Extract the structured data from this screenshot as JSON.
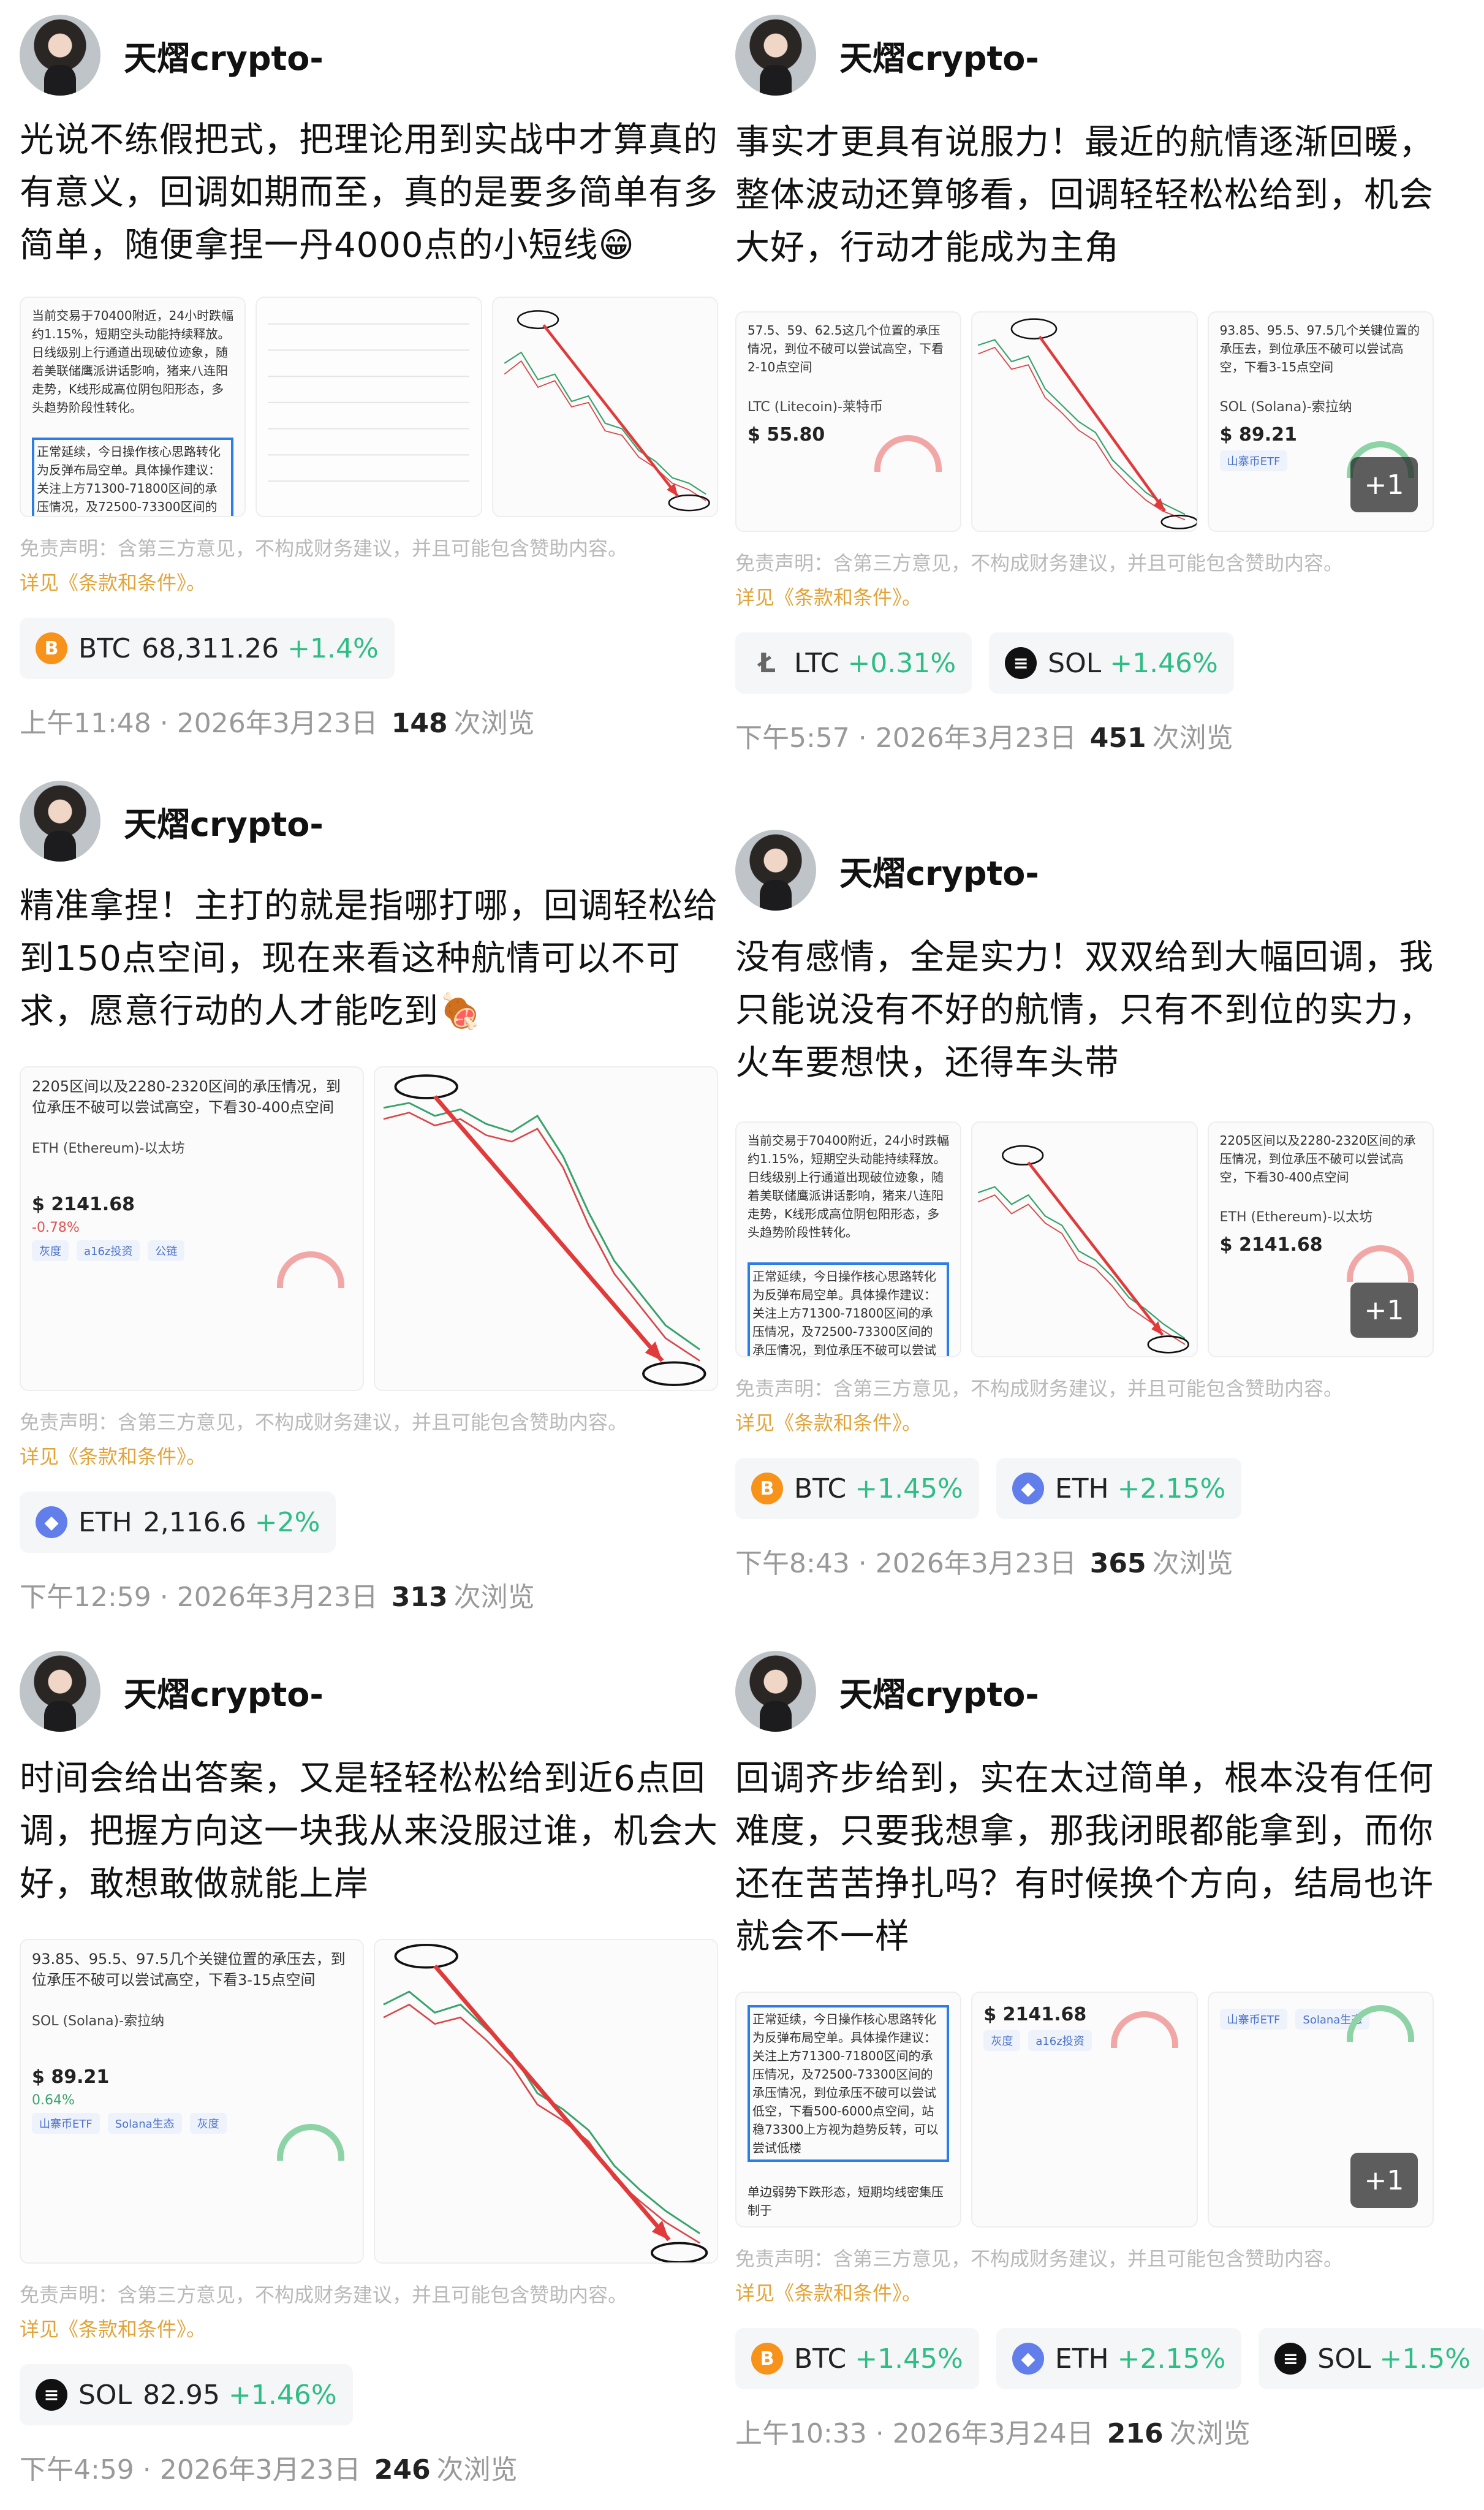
{
  "posts": [
    {
      "author": "天熠crypto-",
      "text": "光说不练假把式，把理论用到实战中才算真的有意义，回调如期而至，真的是要多简单有多简单，随便拿捏一丹4000点的小短线😁",
      "disclaimer": "免责声明：含第三方意见，不构成财务建议，并且可能包含赞助内容。",
      "terms": "详见《条款和条件》。",
      "tickers": [
        {
          "icon": "B",
          "type": "btc",
          "symbol": "BTC",
          "price": "68,311.26",
          "change": "+1.4%"
        }
      ],
      "time": "上午11:48 · 2026年3月23日",
      "views": "148",
      "views_label": "次浏览"
    },
    {
      "author": "天熠crypto-",
      "text": "事实才更具有说服力！最近的航情逐渐回暖，整体波动还算够看，回调轻轻松松给到，机会大好，行动才能成为主角",
      "disclaimer": "免责声明：含第三方意见，不构成财务建议，并且可能包含赞助内容。",
      "terms": "详见《条款和条件》。",
      "tickers": [
        {
          "icon": "Ł",
          "type": "ltc",
          "symbol": "LTC",
          "price": "",
          "change": "+0.31%"
        },
        {
          "icon": "≡",
          "type": "sol",
          "symbol": "SOL",
          "price": "",
          "change": "+1.46%"
        }
      ],
      "time": "下午5:57 · 2026年3月23日",
      "views": "451",
      "views_label": "次浏览",
      "plus": "+1"
    },
    {
      "author": "天熠crypto-",
      "text": "精准拿捏！主打的就是指哪打哪，回调轻松给到150点空间，现在来看这种航情可以不可求，愿意行动的人才能吃到🍖",
      "disclaimer": "免责声明：含第三方意见，不构成财务建议，并且可能包含赞助内容。",
      "terms": "详见《条款和条件》。",
      "tickers": [
        {
          "icon": "◆",
          "type": "eth",
          "symbol": "ETH",
          "price": "2,116.6",
          "change": "+2%"
        }
      ],
      "time": "下午12:59 · 2026年3月23日",
      "views": "313",
      "views_label": "次浏览"
    },
    {
      "author": "天熠crypto-",
      "text": "没有感情，全是实力！双双给到大幅回调，我只能说没有不好的航情，只有不到位的实力，火车要想快，还得车头带",
      "disclaimer": "免责声明：含第三方意见，不构成财务建议，并且可能包含赞助内容。",
      "terms": "详见《条款和条件》。",
      "tickers": [
        {
          "icon": "B",
          "type": "btc",
          "symbol": "BTC",
          "price": "",
          "change": "+1.45%"
        },
        {
          "icon": "◆",
          "type": "eth",
          "symbol": "ETH",
          "price": "",
          "change": "+2.15%"
        }
      ],
      "time": "下午8:43 · 2026年3月23日",
      "views": "365",
      "views_label": "次浏览",
      "plus": "+1"
    },
    {
      "author": "天熠crypto-",
      "text": "时间会给出答案，又是轻轻松松给到近6点回调，把握方向这一块我从来没服过谁，机会大好，敢想敢做就能上岸",
      "disclaimer": "免责声明：含第三方意见，不构成财务建议，并且可能包含赞助内容。",
      "terms": "详见《条款和条件》。",
      "tickers": [
        {
          "icon": "≡",
          "type": "sol",
          "symbol": "SOL",
          "price": "82.95",
          "change": "+1.46%"
        }
      ],
      "time": "下午4:59 · 2026年3月23日",
      "views": "246",
      "views_label": "次浏览"
    },
    {
      "author": "天熠crypto-",
      "text": "回调齐步给到，实在太过简单，根本没有任何难度，只要我想拿，那我闭眼都能拿到，而你还在苦苦挣扎吗？有时候换个方向，结局也许就会不一样",
      "disclaimer": "免责声明：含第三方意见，不构成财务建议，并且可能包含赞助内容。",
      "terms": "详见《条款和条件》。",
      "tickers": [
        {
          "icon": "B",
          "type": "btc",
          "symbol": "BTC",
          "price": "",
          "change": "+1.45%"
        },
        {
          "icon": "◆",
          "type": "eth",
          "symbol": "ETH",
          "price": "",
          "change": "+2.15%"
        },
        {
          "icon": "≡",
          "type": "sol",
          "symbol": "SOL",
          "price": "",
          "change": "+1.5%"
        }
      ],
      "time": "上午10:33 · 2026年3月24日",
      "views": "216",
      "views_label": "次浏览",
      "plus": "+1"
    }
  ],
  "thumbs": {
    "p1_text": "当前交易于70400附近，24小时跌幅约1.15%，短期空头动能持续释放。日线级别上行通道出现破位迹象，随着美联储鹰派讲话影响，猪来八连阳走势，K线形成高位阴包阳形态，多头趋势阶段性转化。",
    "p1_hl": "正常延续，今日操作核心思路转化为反弹布局空单。具体操作建议：关注上方71300-71800区间的承压情况，及72500-73300区间的承压情况，到位承压不破可以尝试低空，下看500-6000点空间，站稳73300上方视为趋势反转，可以尝试低楼",
    "p1_tail": "单边弱势下跌形态，短期均线密集压制于",
    "p2_text": "57.5、59、62.5这几个位置的承压情况，到位不破可以尝试高空，下看2-10点空间",
    "p2_coin": "LTC (Litecoin)-莱特币",
    "p2_price": "$ 55.80",
    "p3_text": "2205区间以及2280-2320区间的承压情况，到位承压不破可以尝试高空，下看30-400点空间",
    "p3_coin": "ETH (Ethereum)-以太坊",
    "p3_price": "$ 2141.68",
    "p3_change": "-0.78%",
    "p5_text": "93.85、95.5、97.5几个关键位置的承压去，到位承压不破可以尝试高空，下看3-15点空间",
    "p5_coin": "SOL (Solana)-索拉纳",
    "p5_price": "$ 89.21",
    "p5_change": "0.64%",
    "chip_a": "灰度",
    "chip_b": "a16z投资",
    "chip_c": "公链",
    "chip_d": "山寨币ETF",
    "chip_e": "Solana生态"
  },
  "colors": {
    "accent_green": "#2fbd85",
    "terms": "#e2a43a",
    "btc": "#f7931a",
    "eth": "#627eea",
    "highlight_border": "#2b7de9",
    "arrow_red": "#e03a3a"
  }
}
